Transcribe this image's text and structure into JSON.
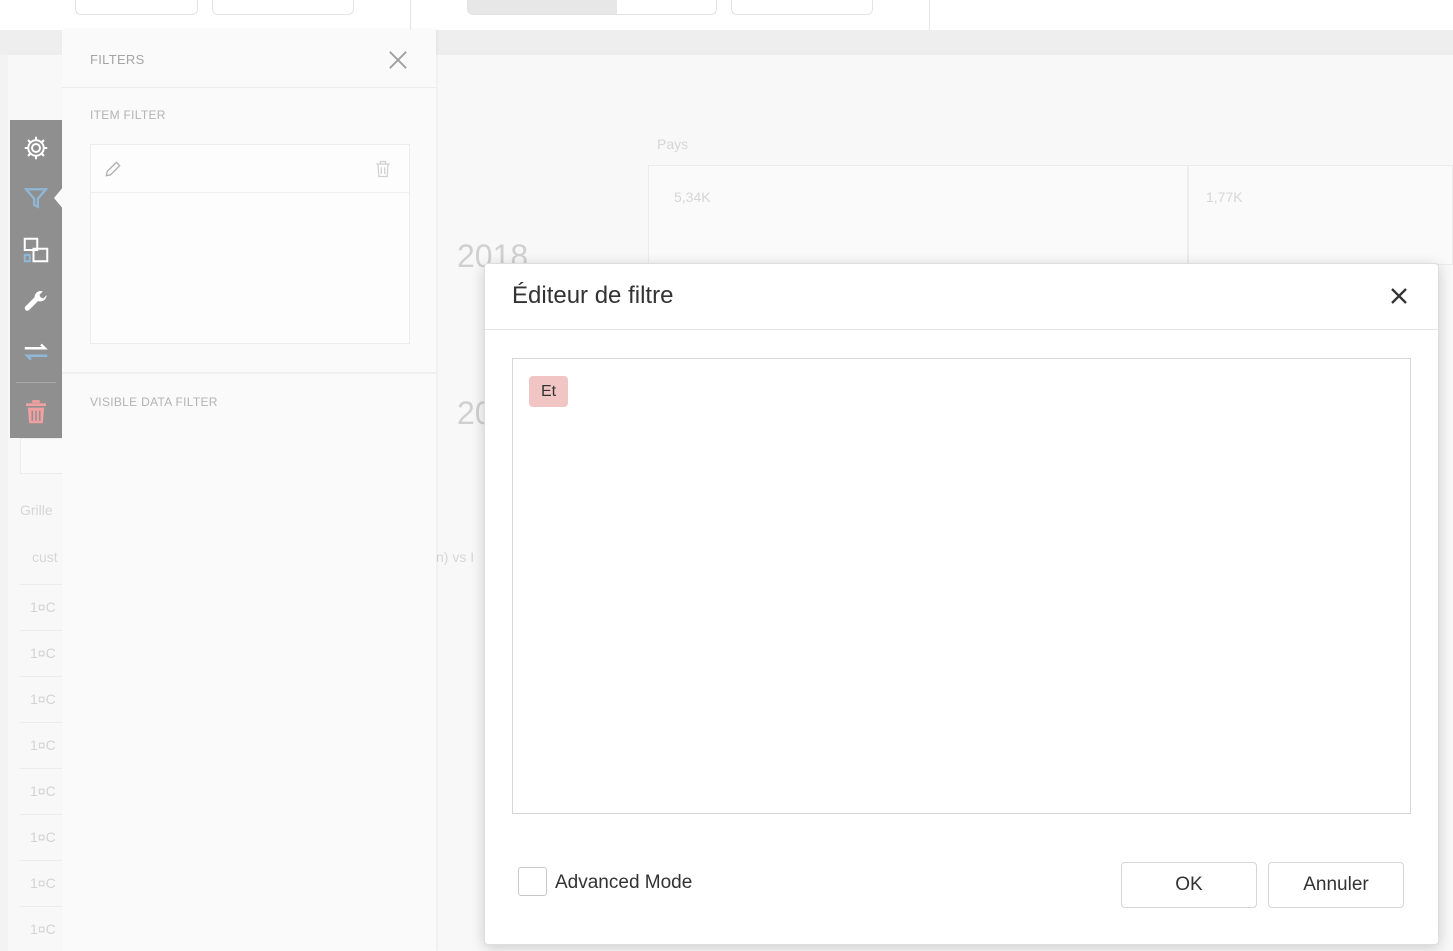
{
  "background": {
    "pays_label": "Pays",
    "value_1": "5,34K",
    "value_2": "1,77K",
    "year_1": "2018",
    "year_2": "20",
    "grid_label": "Grille",
    "column_text_1": "cust",
    "column_text_2": "n) vs I",
    "row_prefix": "1¤C"
  },
  "toolbar": {
    "items": [
      "gear-icon",
      "filter-icon",
      "layout-icon",
      "wrench-icon",
      "swap-icon",
      "delete-icon"
    ],
    "colors": {
      "background": "#8f8f8f",
      "icon": "#ffffff",
      "active_icon": "#8fb8d8",
      "delete_icon": "#f0a0a0"
    }
  },
  "filters_panel": {
    "title": "FILTERS",
    "item_filter_label": "ITEM FILTER",
    "visible_data_filter_label": "VISIBLE DATA FILTER"
  },
  "dialog": {
    "title": "Éditeur de filtre",
    "group_operator": "Et",
    "advanced_mode_label": "Advanced Mode",
    "advanced_mode_checked": false,
    "ok_label": "OK",
    "cancel_label": "Annuler",
    "colors": {
      "chip_background": "#f2c5c5"
    }
  }
}
